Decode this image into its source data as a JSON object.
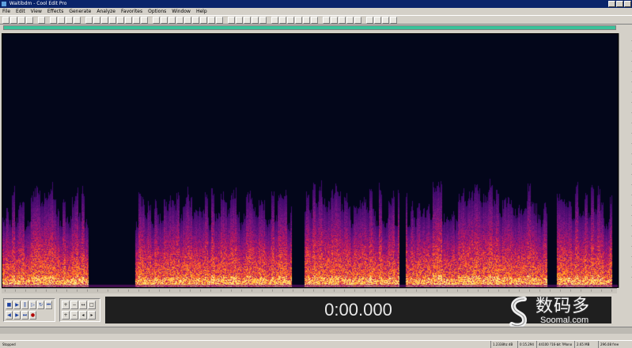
{
  "window": {
    "title": "Waitibdm - Cool Edit Pro"
  },
  "menu": [
    "File",
    "Edit",
    "View",
    "Effects",
    "Generate",
    "Analyze",
    "Favorites",
    "Options",
    "Window",
    "Help"
  ],
  "toolbar": {
    "button_count": 46
  },
  "spectrogram": {
    "colors": {
      "background": "#03061a",
      "low": "#3a0a6a",
      "mid": "#c2185b",
      "high": "#ff7a00",
      "peak": "#fff3a0"
    }
  },
  "time_display": {
    "value": "0:00.000"
  },
  "watermark": {
    "name": "数码多",
    "url": "Soomal.com"
  },
  "status": {
    "state": "Stopped",
    "level": "1.2338hz dB",
    "position": "0:15.294",
    "format": "44100 ?16-bit ?Mono",
    "size": "2.65 MB",
    "free": "296.08 free"
  }
}
